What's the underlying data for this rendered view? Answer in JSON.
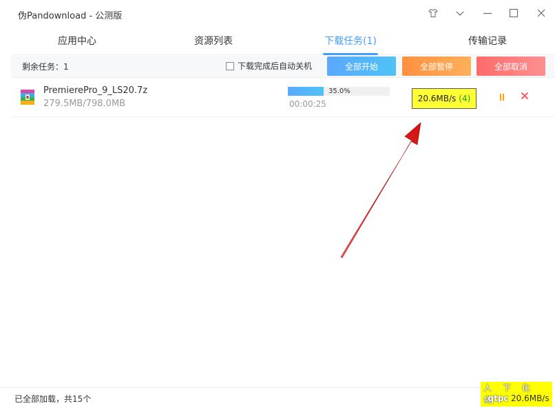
{
  "window": {
    "title": "伪Pandownload - 公测版",
    "controls": [
      "shirt-icon",
      "chevron-down-icon",
      "minimize-icon",
      "maximize-icon",
      "close-icon"
    ]
  },
  "tabs": [
    {
      "label": "应用中心",
      "active": false
    },
    {
      "label": "资源列表",
      "active": false
    },
    {
      "label": "下载任务(1)",
      "active": true
    },
    {
      "label": "传输记录",
      "active": false
    }
  ],
  "toolbar": {
    "remaining": "剩余任务：1",
    "auto_shutdown_label": "下载完成后自动关机",
    "auto_shutdown_checked": false,
    "start_all": "全部开始",
    "pause_all": "全部暂停",
    "cancel_all": "全部取消"
  },
  "tasks": [
    {
      "file_name": "PremierePro_9_LS20.7z",
      "size": "279.5MB/798.0MB",
      "progress_percent": 35.0,
      "progress_text": "35.0%",
      "elapsed": "00:00:25",
      "speed": "20.6MB/s",
      "threads": "(4)",
      "file_icon": "archive-icon"
    }
  ],
  "status": {
    "loaded": "已全部加载，共15个"
  },
  "watermark": {
    "line1": "人 下 化 化",
    "line2": ".qtpc",
    "speed": "20.6MB/s"
  },
  "colors": {
    "accent": "#409eff",
    "start": "#5aa8ff",
    "pause": "#ff9040",
    "cancel": "#ff6b6b",
    "highlight": "#ffff33",
    "annotation_arrow": "#e02020"
  }
}
